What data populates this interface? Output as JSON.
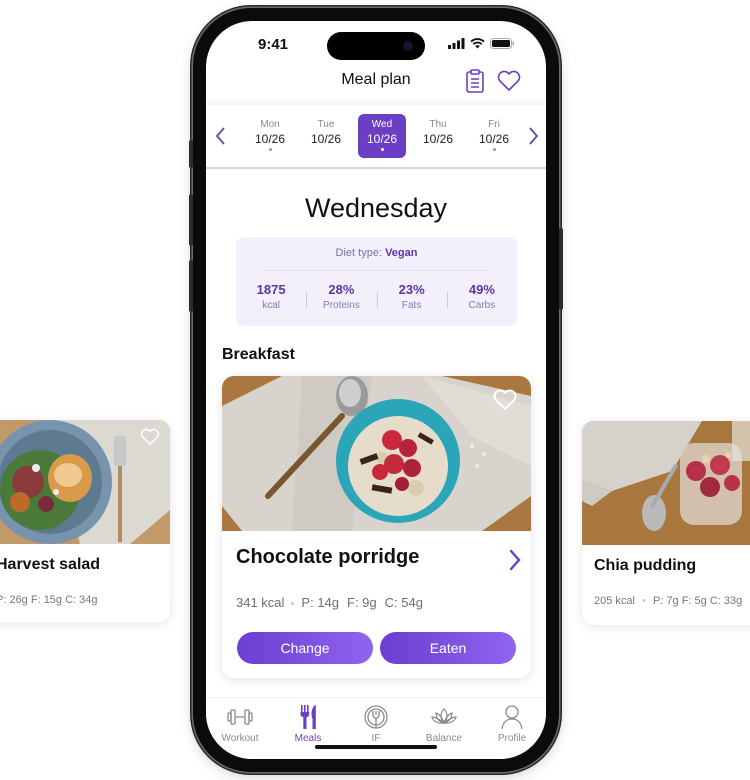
{
  "status_bar": {
    "time": "9:41"
  },
  "header": {
    "title": "Meal plan",
    "icons": [
      "clipboard-icon",
      "heart-icon"
    ]
  },
  "week": {
    "prev_icon": "chevron-left-icon",
    "next_icon": "chevron-right-icon",
    "days": [
      {
        "name": "Mon",
        "date": "10/26",
        "active": false
      },
      {
        "name": "Tue",
        "date": "10/26",
        "active": false
      },
      {
        "name": "Wed",
        "date": "10/26",
        "active": true
      },
      {
        "name": "Thu",
        "date": "10/26",
        "active": false
      },
      {
        "name": "Fri",
        "date": "10/26",
        "active": false
      }
    ]
  },
  "day_heading": "Wednesday",
  "summary": {
    "diet_label": "Diet type:",
    "diet_value": "Vegan",
    "stats": [
      {
        "value": "1875",
        "label": "kcal"
      },
      {
        "value": "28%",
        "label": "Proteins"
      },
      {
        "value": "23%",
        "label": "Fats"
      },
      {
        "value": "49%",
        "label": "Carbs"
      }
    ]
  },
  "section_title": "Breakfast",
  "meal": {
    "name": "Chocolate porridge",
    "kcal": "341 kcal",
    "protein": "P: 14g",
    "fat": "F: 9g",
    "carbs": "C: 54g",
    "change_label": "Change",
    "eaten_label": "Eaten",
    "favorite_icon": "heart-outline-icon"
  },
  "side_cards": {
    "left": {
      "title": "Harvest salad",
      "macros": "P: 26g  F: 15g  C: 34g"
    },
    "right": {
      "title": "Chia pudding",
      "kcal": "205 kcal",
      "macros": "P: 7g   F: 5g   C: 33g"
    }
  },
  "tabs": [
    {
      "label": "Workout",
      "icon": "dumbbell-icon",
      "active": false
    },
    {
      "label": "Meals",
      "icon": "fork-knife-icon",
      "active": true
    },
    {
      "label": "IF",
      "icon": "plate-fork-icon",
      "active": false
    },
    {
      "label": "Balance",
      "icon": "lotus-icon",
      "active": false
    },
    {
      "label": "Profile",
      "icon": "person-icon",
      "active": false
    }
  ],
  "colors": {
    "accent": "#6a3fc4",
    "summary_bg": "#f3f0fc",
    "button_gradient_start": "#6a3fd0",
    "button_gradient_end": "#8f64ef"
  }
}
